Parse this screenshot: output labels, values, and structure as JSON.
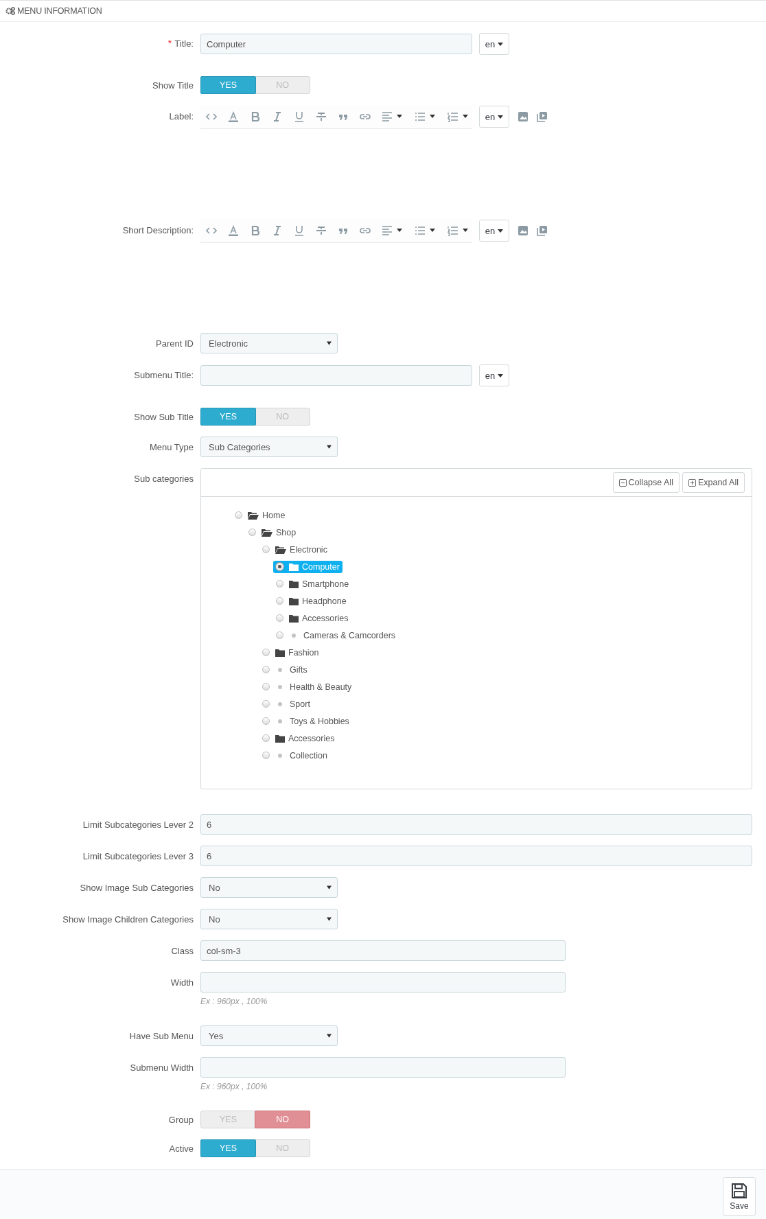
{
  "header": {
    "title": "MENU INFORMATION"
  },
  "fields": [
    {
      "kind": "text",
      "label": "Title:",
      "required_mark": "*",
      "value": "Computer",
      "lang": "en"
    },
    {
      "kind": "switch",
      "label": "Show Title",
      "yes": "YES",
      "no": "NO",
      "on": true
    },
    {
      "kind": "editor",
      "label": "Label:",
      "lang": "en"
    },
    {
      "kind": "editor",
      "label": "Short Description:",
      "lang": "en"
    },
    {
      "kind": "select",
      "label": "Parent ID",
      "value": "Electronic"
    },
    {
      "kind": "text",
      "label": "Submenu Title:",
      "lang": "en"
    },
    {
      "kind": "switch",
      "label": "Show Sub Title",
      "yes": "YES",
      "no": "NO",
      "on": true
    },
    {
      "kind": "select",
      "label": "Menu Type",
      "value": "Sub Categories"
    },
    {
      "kind": "tree",
      "label": "Sub categories",
      "collapse": "Collapse All",
      "expand": "Expand All",
      "tree": [
        {
          "kind": "folder",
          "label": "Home",
          "expanded": true,
          "selected": false,
          "children": [
            {
              "kind": "folder",
              "label": "Shop",
              "expanded": true,
              "selected": false,
              "children": [
                {
                  "kind": "folder",
                  "label": "Electronic",
                  "expanded": true,
                  "selected": false,
                  "children": [
                    {
                      "kind": "folder",
                      "label": "Computer",
                      "expanded": false,
                      "selected": true
                    },
                    {
                      "kind": "folder",
                      "label": "Smartphone",
                      "expanded": false,
                      "selected": false
                    },
                    {
                      "kind": "folder",
                      "label": "Headphone",
                      "expanded": false,
                      "selected": false
                    },
                    {
                      "kind": "folder",
                      "label": "Accessories",
                      "expanded": false,
                      "selected": false
                    },
                    {
                      "kind": "leaf",
                      "label": "Cameras & Camcorders",
                      "selected": false
                    }
                  ]
                },
                {
                  "kind": "folder",
                  "label": "Fashion",
                  "expanded": false,
                  "selected": false
                },
                {
                  "kind": "leaf",
                  "label": "Gifts",
                  "selected": false
                },
                {
                  "kind": "leaf",
                  "label": "Health & Beauty",
                  "selected": false
                },
                {
                  "kind": "leaf",
                  "label": "Sport",
                  "selected": false
                },
                {
                  "kind": "leaf",
                  "label": "Toys & Hobbies",
                  "selected": false
                },
                {
                  "kind": "folder",
                  "label": "Accessories",
                  "expanded": false,
                  "selected": false
                },
                {
                  "kind": "leaf",
                  "label": "Collection",
                  "selected": false
                }
              ]
            }
          ]
        }
      ]
    },
    {
      "kind": "wide-text",
      "label": "Limit Subcategories Lever 2",
      "value": "6"
    },
    {
      "kind": "wide-text",
      "label": "Limit Subcategories Lever 3",
      "value": "6"
    },
    {
      "kind": "select",
      "label": "Show Image Sub Categories",
      "value": "No"
    },
    {
      "kind": "select",
      "label": "Show Image Children Categories",
      "value": "No"
    },
    {
      "kind": "text",
      "label": "Class",
      "value": "col-sm-3"
    },
    {
      "kind": "text",
      "label": "Width",
      "hint": "Ex : 960px , 100%"
    },
    {
      "kind": "select",
      "label": "Have Sub Menu",
      "value": "Yes"
    },
    {
      "kind": "text",
      "label": "Submenu Width",
      "hint": "Ex : 960px , 100%"
    },
    {
      "kind": "switch",
      "label": "Group",
      "yes": "YES",
      "no": "NO",
      "on": false
    },
    {
      "kind": "switch",
      "label": "Active",
      "yes": "YES",
      "no": "NO",
      "on": true
    }
  ],
  "footer": {
    "save": "Save"
  }
}
